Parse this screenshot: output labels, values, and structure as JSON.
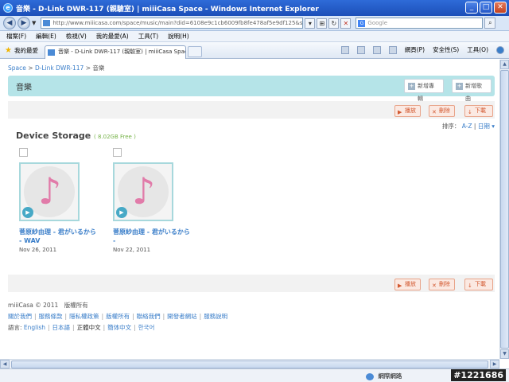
{
  "window": {
    "title": "音樂 - D-Link DWR-117 (親驗室) | miiiCasa Space - Windows Internet Explorer"
  },
  "address": {
    "url": "http://www.miiicasa.com/space/music/main?did=6108e9c1cb6009fb8fe478af5e9df125&sort=",
    "search_placeholder": "Google"
  },
  "menu": [
    "檔案(F)",
    "編輯(E)",
    "檢視(V)",
    "我的最愛(A)",
    "工具(T)",
    "說明(H)"
  ],
  "favorites": {
    "label": "我的最愛",
    "tab_title": "音樂 - D-Link DWR-117 (親驗室) | miiiCasa Space"
  },
  "commands": {
    "page": "網頁(P)",
    "safety": "安全性(S)",
    "tools": "工具(O)"
  },
  "breadcrumb": {
    "space": "Space",
    "device": "D-Link DWR-117",
    "current": "音樂",
    "sep": ">"
  },
  "header": {
    "title": "音樂",
    "new_album": "新增專輯",
    "new_song": "新增歌曲"
  },
  "actions": {
    "play": "播放",
    "delete": "刪除",
    "download": "下載"
  },
  "sort": {
    "label": "排序：",
    "az": "A-Z",
    "date": "日期"
  },
  "storage": {
    "title": "Device Storage",
    "free": "( 8.02GB Free )"
  },
  "songs": [
    {
      "title": "菅原紗由理 - 君がいるから - WAV",
      "date": "Nov 26, 2011"
    },
    {
      "title": "菅原紗由理 - 君がいるから -",
      "date": "Nov 22, 2011"
    }
  ],
  "footer": {
    "copyright": "miiiCasa © 2011　版權所有",
    "links": [
      "關於我們",
      "服務條款",
      "隱私權政策",
      "版權所有",
      "聯絡我們",
      "開發者網站",
      "服務說明"
    ],
    "lang_label": "語言:",
    "languages": [
      "English",
      "日本語",
      "正體中文",
      "簡体中文",
      "한국어"
    ]
  },
  "status": {
    "network": "網際網路",
    "watermark": "#1221686"
  }
}
